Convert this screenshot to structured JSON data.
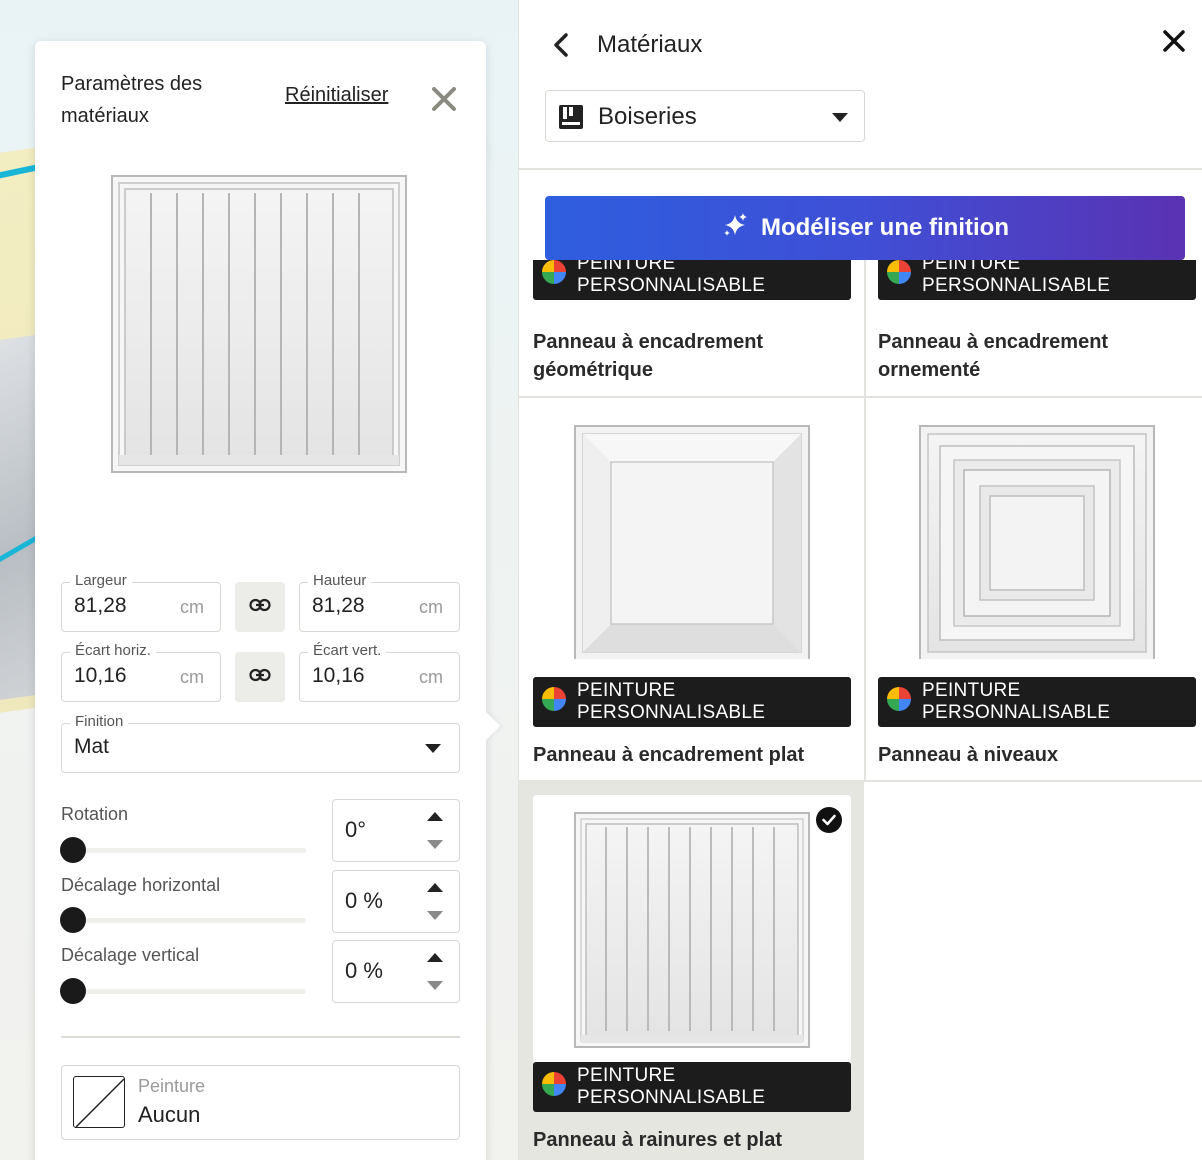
{
  "settings": {
    "title": "Paramètres des matériaux",
    "reset_label": "Réinitialiser",
    "width": {
      "label": "Largeur",
      "value": "81,28",
      "unit": "cm"
    },
    "height": {
      "label": "Hauteur",
      "value": "81,28",
      "unit": "cm"
    },
    "gap_h": {
      "label": "Écart horiz.",
      "value": "10,16",
      "unit": "cm"
    },
    "gap_v": {
      "label": "Écart vert.",
      "value": "10,16",
      "unit": "cm"
    },
    "finish": {
      "label": "Finition",
      "value": "Mat"
    },
    "rotation": {
      "label": "Rotation",
      "value": "0°",
      "level": 0
    },
    "offset_h": {
      "label": "Décalage horizontal",
      "value": "0 %",
      "level": 0
    },
    "offset_v": {
      "label": "Décalage vertical",
      "value": "0 %",
      "level": 0
    },
    "paint": {
      "label": "Peinture",
      "value": "Aucun"
    }
  },
  "materials": {
    "title": "Matériaux",
    "category": "Boiseries",
    "cta_label": "Modéliser une finition",
    "badge_label": "PEINTURE PERSONNALISABLE",
    "items": [
      {
        "name": "Panneau à encadrement géométrique"
      },
      {
        "name": "Panneau à encadrement ornementé"
      },
      {
        "name": "Panneau à encadrement plat"
      },
      {
        "name": "Panneau à niveaux"
      },
      {
        "name": "Panneau à rainures et plat",
        "selected": true
      }
    ]
  },
  "icons": {
    "close": "close-icon",
    "back": "chevron-left-icon",
    "link": "link-icon",
    "category": "book-icon",
    "sparkle": "sparkle-icon",
    "check": "check-icon",
    "color_wheel": "color-wheel-icon"
  },
  "colors": {
    "cta_start": "#2e5ede",
    "cta_end": "#5a32b3",
    "badge_bg": "#1c1c1c",
    "selected_bg": "#e6e6e0"
  }
}
